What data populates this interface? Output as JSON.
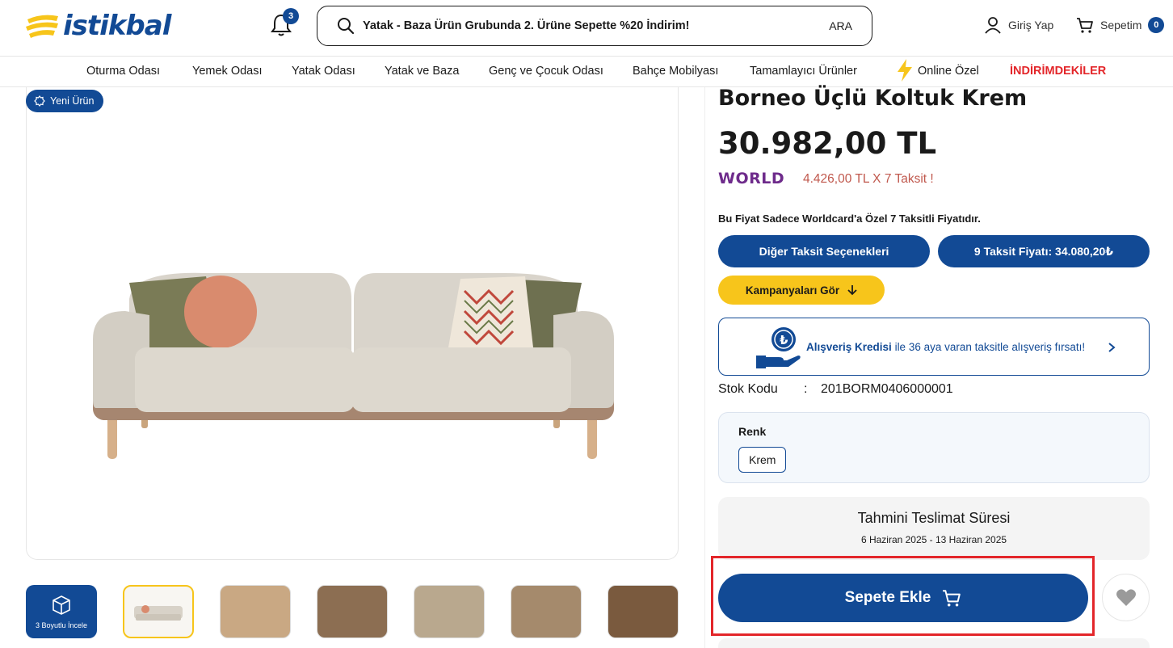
{
  "header": {
    "logo_text": "istikbal",
    "notifications_count": "3",
    "search_text": "Yatak - Baza Ürün Grubunda 2. Ürüne Sepette %20 İndirim!",
    "search_button": "ARA",
    "login_label": "Giriş Yap",
    "cart_label": "Sepetim",
    "cart_count": "0"
  },
  "nav": {
    "items": [
      "Oturma Odası",
      "Yemek Odası",
      "Yatak Odası",
      "Yatak ve Baza",
      "Genç ve Çocuk Odası",
      "Bahçe Mobilyası",
      "Tamamlayıcı Ürünler",
      "Online Özel",
      "İNDİRİMDEKİLER"
    ]
  },
  "gallery": {
    "new_badge": "Yeni Ürün",
    "threed_label": "3 Boyutlu İncele"
  },
  "product": {
    "title": "Borneo Üçlü Koltuk Krem",
    "price": "30.982,00 TL",
    "world_brand": "WORLD",
    "installment_text": "4.426,00 TL X 7 Taksit !",
    "price_note": "Bu Fiyat Sadece Worldcard'a Özel 7 Taksitli Fiyatıdır.",
    "other_installments_button": "Diğer Taksit Seçenekleri",
    "nine_installment_button": "9 Taksit Fiyatı: 34.080,20₺",
    "campaigns_button": "Kampanyaları Gör",
    "credit_bold": "Alışveriş Kredisi",
    "credit_rest": " ile 36 aya varan taksitle alışveriş fırsatı!",
    "stock_label": "Stok Kodu",
    "stock_colon": ":",
    "stock_code": "201BORM0406000001",
    "color_label": "Renk",
    "color_value": "Krem",
    "delivery_title": "Tahmini Teslimat Süresi",
    "delivery_dates": "6 Haziran 2025 - 13 Haziran 2025",
    "add_to_cart": "Sepete Ekle"
  },
  "colors": {
    "brand_blue": "#124a95",
    "accent_yellow": "#f7c51b",
    "sale_red": "#e3262a",
    "world_purple": "#6e2b8b"
  }
}
